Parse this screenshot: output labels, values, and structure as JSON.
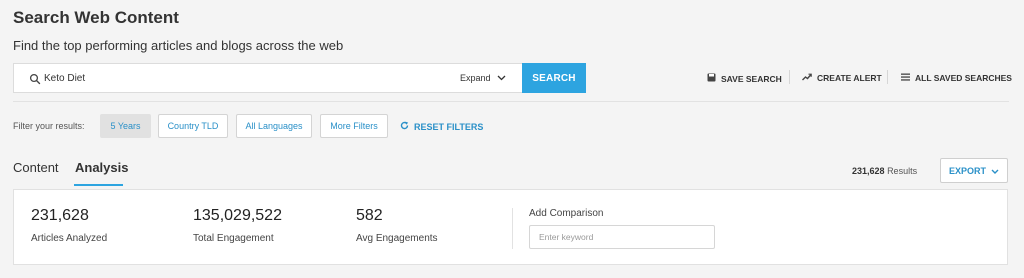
{
  "header": {
    "title": "Search Web Content",
    "subtitle": "Find the top performing articles and blogs across the web"
  },
  "search": {
    "query": "Keto Diet",
    "expand_label": "Expand",
    "button_label": "SEARCH"
  },
  "toolbar": {
    "save_search": "SAVE SEARCH",
    "create_alert": "CREATE ALERT",
    "all_saved_searches": "ALL SAVED SEARCHES"
  },
  "filters": {
    "label": "Filter your results:",
    "chips": [
      "5 Years",
      "Country TLD",
      "All Languages",
      "More Filters"
    ],
    "active_chip": "5 Years",
    "reset_label": "RESET FILTERS"
  },
  "tabs": {
    "items": [
      "Content",
      "Analysis"
    ],
    "active": "Analysis"
  },
  "results": {
    "count": "231,628",
    "label": "Results",
    "export_label": "EXPORT"
  },
  "stats": [
    {
      "value": "231,628",
      "label": "Articles Analyzed"
    },
    {
      "value": "135,029,522",
      "label": "Total Engagement"
    },
    {
      "value": "582",
      "label": "Avg Engagements"
    }
  ],
  "comparison": {
    "label": "Add Comparison",
    "placeholder": "Enter keyword"
  },
  "colors": {
    "accent": "#2da4e0",
    "link": "#2a90c8",
    "background": "#f4f4f4"
  }
}
